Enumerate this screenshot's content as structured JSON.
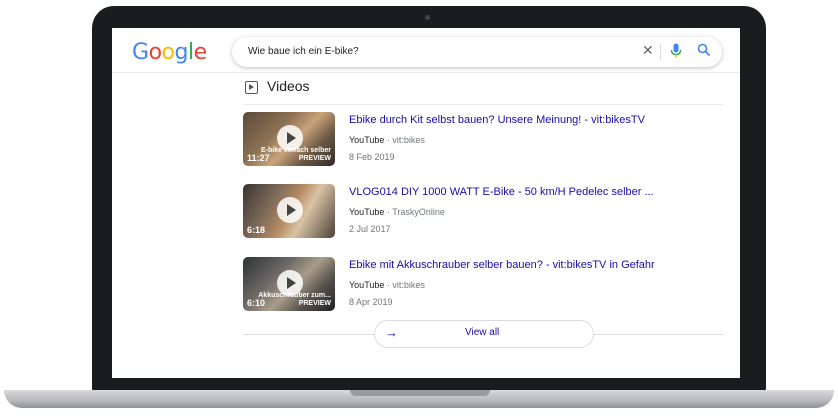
{
  "search": {
    "query": "Wie baue ich ein E-bike?"
  },
  "logo": {
    "letters": [
      "G",
      "o",
      "o",
      "g",
      "l",
      "e"
    ],
    "colors": [
      "#4285F4",
      "#EA4335",
      "#FBBC05",
      "#4285F4",
      "#34A853",
      "#EA4335"
    ]
  },
  "icons": {
    "clear": "close-icon",
    "mic": "microphone-icon",
    "search": "search-icon",
    "videos": "video-icon",
    "play": "play-icon",
    "arrow": "arrow-right-icon"
  },
  "section": {
    "title": "Videos"
  },
  "videos": [
    {
      "title": "Ebike durch Kit selbst bauen? Unsere Meinung! - vit:bikesTV",
      "platform": "YouTube",
      "channel": "vit:bikes",
      "date": "8 Feb 2019",
      "duration": "11:27",
      "thumb_text": "E-bike einfach selber PREVIEW"
    },
    {
      "title": "VLOG014 DIY 1000 WATT E-Bike - 50 km/H Pedelec selber ...",
      "platform": "YouTube",
      "channel": "TraskyOnline",
      "date": "2 Jul 2017",
      "duration": "6:18",
      "thumb_text": ""
    },
    {
      "title": "Ebike mit Akkuschrauber selber bauen? - vit:bikesTV in Gefahr",
      "platform": "YouTube",
      "channel": "vit:bikes",
      "date": "8 Apr 2019",
      "duration": "6:10",
      "thumb_text": "Akkuschrauber zum... PREVIEW"
    }
  ],
  "source_separator": " · ",
  "view_all": {
    "label": "View all"
  }
}
